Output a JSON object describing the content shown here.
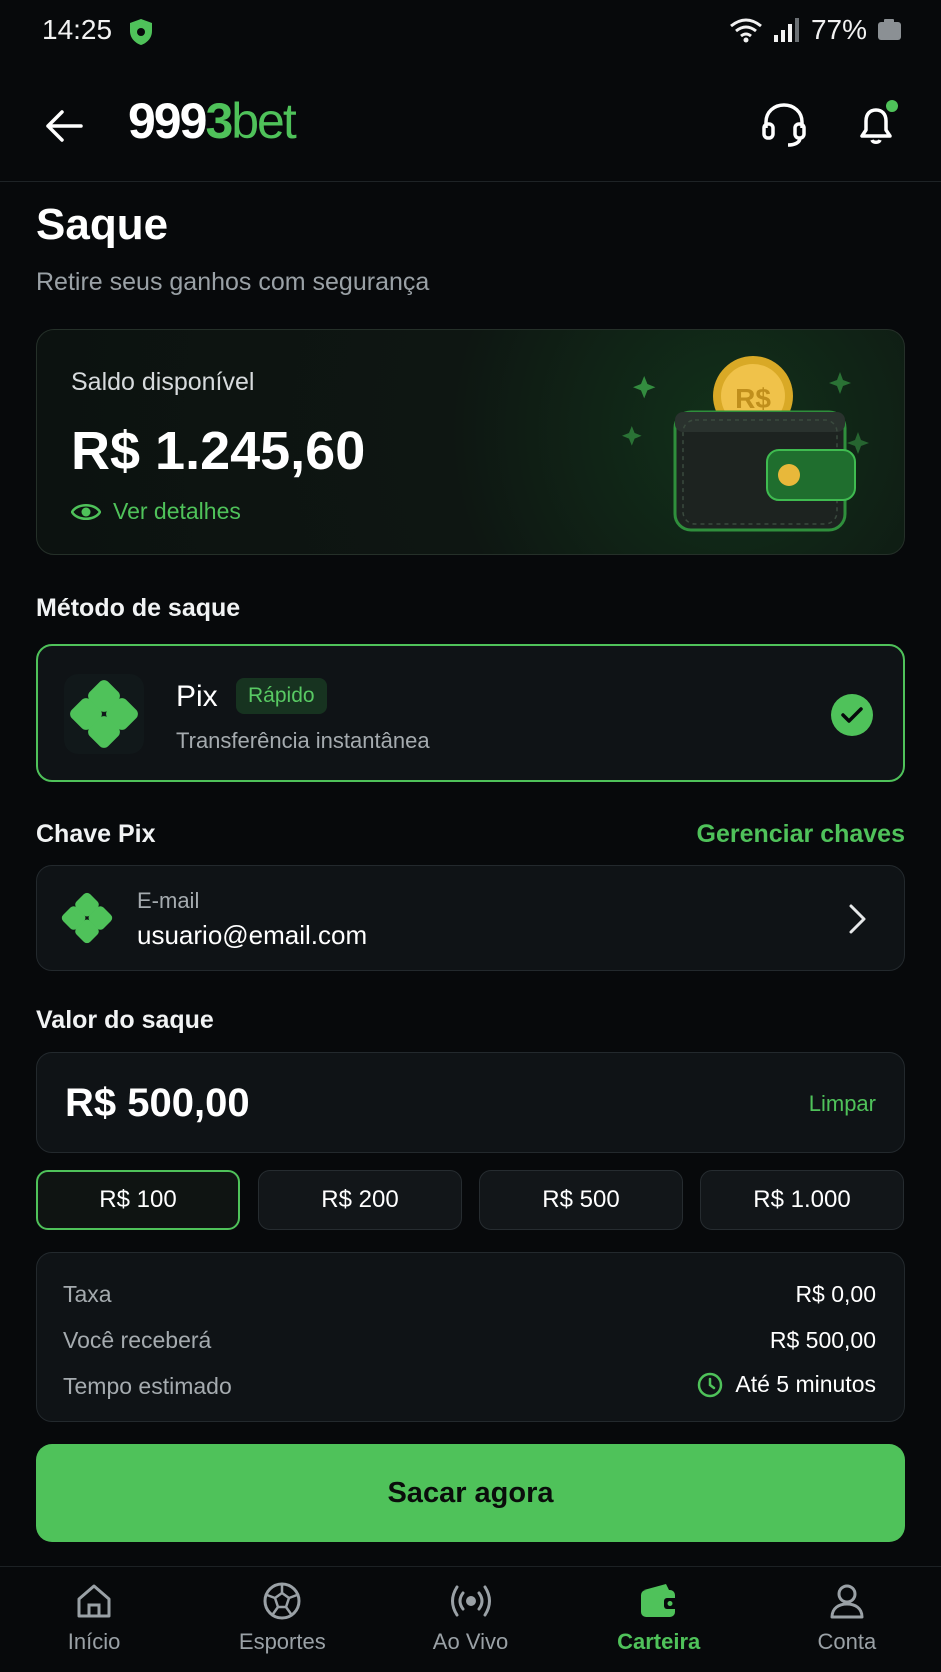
{
  "status_bar": {
    "time": "14:25",
    "battery": "77%"
  },
  "header": {
    "logo_part1": "999",
    "logo_part2": "3",
    "logo_part3": "bet"
  },
  "page": {
    "title": "Saque",
    "subtitle": "Retire seus ganhos com segurança"
  },
  "balance": {
    "label": "Saldo disponível",
    "value": "R$ 1.245,60",
    "details_link": "Ver detalhes",
    "coin_label": "R$"
  },
  "method": {
    "section_label": "Método de saque",
    "name": "Pix",
    "badge": "Rápido",
    "description": "Transferência instantânea"
  },
  "pix_key": {
    "section_label": "Chave Pix",
    "manage_link": "Gerenciar chaves",
    "type": "E-mail",
    "value": "usuario@email.com"
  },
  "amount": {
    "section_label": "Valor do saque",
    "value": "R$ 500,00",
    "clear": "Limpar",
    "chips": [
      "R$ 100",
      "R$ 200",
      "R$ 500",
      "R$ 1.000"
    ]
  },
  "summary": {
    "fee_label": "Taxa",
    "fee_value": "R$ 0,00",
    "receive_label": "Você receberá",
    "receive_value": "R$ 500,00",
    "time_label": "Tempo estimado",
    "time_value": "Até 5 minutos"
  },
  "cta": {
    "label": "Sacar agora"
  },
  "bottom_nav": {
    "items": [
      "Início",
      "Esportes",
      "Ao Vivo",
      "Carteira",
      "Conta"
    ],
    "active": "Carteira"
  },
  "colors": {
    "accent": "#4fc25a",
    "background": "#07090b",
    "card": "#0f1316"
  }
}
